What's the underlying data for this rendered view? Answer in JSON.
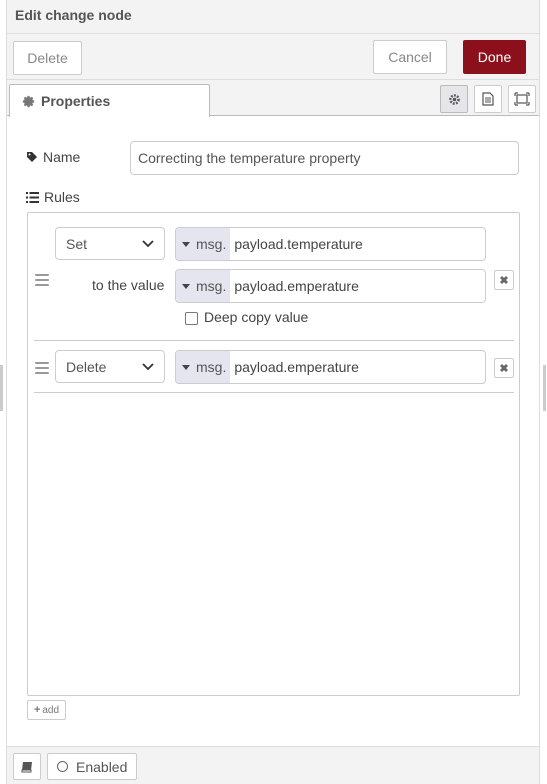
{
  "header": {
    "title": "Edit change node",
    "delete_label": "Delete",
    "cancel_label": "Cancel",
    "done_label": "Done"
  },
  "tabs": {
    "properties_label": "Properties",
    "icons": [
      "gear-icon",
      "description-icon",
      "appearance-icon"
    ]
  },
  "form": {
    "name_label": "Name",
    "name_value": "Correcting the temperature property",
    "rules_label": "Rules"
  },
  "rules": [
    {
      "action": "Set",
      "target_type": "msg.",
      "target_value": "payload.temperature",
      "to_label": "to the value",
      "value_type": "msg.",
      "value_value": "payload.emperature",
      "deep_copy_label": "Deep copy value",
      "deep_copy_checked": false
    },
    {
      "action": "Delete",
      "target_type": "msg.",
      "target_value": "payload.emperature"
    }
  ],
  "add_label": "add",
  "footer": {
    "enabled_label": "Enabled"
  },
  "colors": {
    "done_button": "#8c101c",
    "typed_input_bg": "#e5e5f0"
  }
}
